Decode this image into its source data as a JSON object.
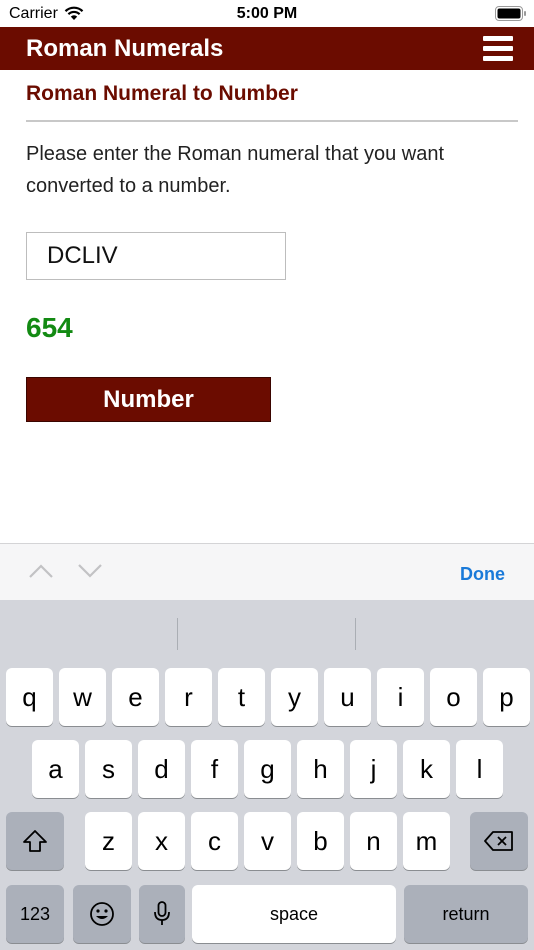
{
  "status_bar": {
    "carrier": "Carrier",
    "time": "5:00 PM"
  },
  "header": {
    "title": "Roman Numerals",
    "menu_icon": "hamburger-menu-icon",
    "color": "#6b0c00"
  },
  "main": {
    "section_title": "Roman Numeral to Number",
    "instructions": "Please enter the Roman numeral that you want converted to a number.",
    "input_value": "DCLIV",
    "result": "654",
    "result_color": "#138a13",
    "button_label": "Number"
  },
  "accessory_bar": {
    "prev_icon": "chevron-up-icon",
    "next_icon": "chevron-down-icon",
    "done_label": "Done",
    "done_color": "#1a7ad9"
  },
  "keyboard": {
    "row1": [
      "q",
      "w",
      "e",
      "r",
      "t",
      "y",
      "u",
      "i",
      "o",
      "p"
    ],
    "row2": [
      "a",
      "s",
      "d",
      "f",
      "g",
      "h",
      "j",
      "k",
      "l"
    ],
    "row3": [
      "z",
      "x",
      "c",
      "v",
      "b",
      "n",
      "m"
    ],
    "numbers_label": "123",
    "space_label": "space",
    "return_label": "return",
    "shift_icon": "shift-icon",
    "delete_icon": "backspace-icon",
    "emoji_icon": "emoji-icon",
    "mic_icon": "microphone-icon"
  }
}
